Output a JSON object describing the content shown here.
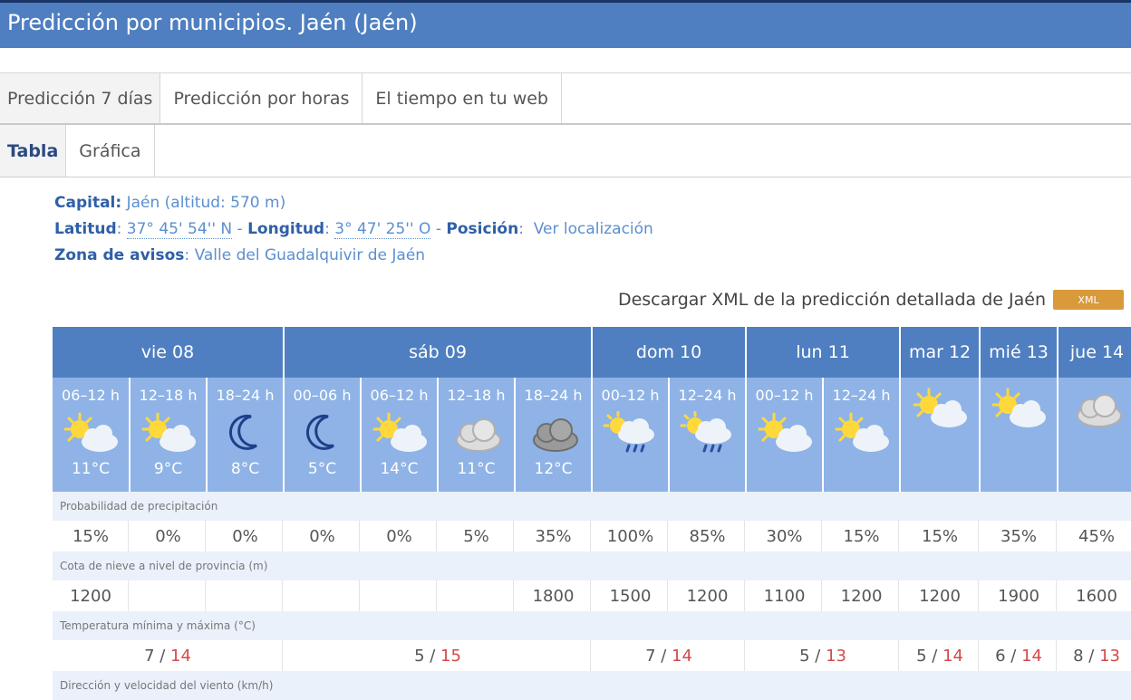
{
  "title": "Predicción por municipios. Jaén (Jaén)",
  "tabs_main": [
    "Predicción 7 días",
    "Predicción por horas",
    "El tiempo en tu web"
  ],
  "tabs_sub": [
    "Tabla",
    "Gráfica"
  ],
  "info": {
    "capital_label": "Capital:",
    "capital_value": "Jaén (altitud: 570 m)",
    "lat_label": "Latitud",
    "lat_value": "37° 45' 54'' N",
    "lon_label": "Longitud",
    "lon_value": "3° 47' 25'' O",
    "pos_label": "Posición",
    "pos_link": "Ver localización",
    "zona_label": "Zona de avisos",
    "zona_value": "Valle del Guadalquivir de Jaén"
  },
  "download": {
    "text": "Descargar XML de la predicción detallada de Jaén",
    "button": "XML"
  },
  "days": [
    {
      "name": "vie 08"
    },
    {
      "name": "sáb 09"
    },
    {
      "name": "dom 10"
    },
    {
      "name": "lun 11"
    },
    {
      "name": "mar 12"
    },
    {
      "name": "mié 13"
    },
    {
      "name": "jue 14"
    }
  ],
  "periods": [
    {
      "label": "06–12 h",
      "icon": "partly-cloudy-sun",
      "temp": "11°C"
    },
    {
      "label": "12–18 h",
      "icon": "partly-cloudy-sun",
      "temp": "9°C"
    },
    {
      "label": "18–24 h",
      "icon": "moon",
      "temp": "8°C"
    },
    {
      "label": "00–06 h",
      "icon": "moon",
      "temp": "5°C"
    },
    {
      "label": "06–12 h",
      "icon": "partly-cloudy-sun",
      "temp": "14°C"
    },
    {
      "label": "12–18 h",
      "icon": "cloudy",
      "temp": "11°C"
    },
    {
      "label": "18–24 h",
      "icon": "dark-cloudy",
      "temp": "12°C"
    },
    {
      "label": "00–12 h",
      "icon": "sun-rain",
      "temp": ""
    },
    {
      "label": "12–24 h",
      "icon": "sun-rain",
      "temp": ""
    },
    {
      "label": "00–12 h",
      "icon": "partly-cloudy-sun",
      "temp": ""
    },
    {
      "label": "12–24 h",
      "icon": "partly-cloudy-sun",
      "temp": ""
    },
    {
      "label": "",
      "icon": "partly-cloudy-sun",
      "temp": ""
    },
    {
      "label": "",
      "icon": "partly-cloudy-sun",
      "temp": ""
    },
    {
      "label": "",
      "icon": "cloudy",
      "temp": ""
    }
  ],
  "rows": {
    "precip_label": "Probabilidad de precipitación",
    "precip": [
      "15%",
      "0%",
      "0%",
      "0%",
      "0%",
      "5%",
      "35%",
      "100%",
      "85%",
      "30%",
      "15%",
      "15%",
      "35%",
      "45%"
    ],
    "snow_label": "Cota de nieve a nivel de provincia (m)",
    "snow": [
      "1200",
      "",
      "",
      "",
      "",
      "",
      "1800",
      "1500",
      "1200",
      "1100",
      "1200",
      "1200",
      "1900",
      "1600"
    ],
    "temp_label": "Temperatura mínima y máxima (°C)",
    "temps": [
      {
        "min": "7",
        "max": "14"
      },
      {
        "min": "5",
        "max": "15"
      },
      {
        "min": "7",
        "max": "14"
      },
      {
        "min": "5",
        "max": "13"
      },
      {
        "min": "5",
        "max": "14"
      },
      {
        "min": "6",
        "max": "14"
      },
      {
        "min": "8",
        "max": "13"
      }
    ],
    "wind_label": "Dirección y velocidad del viento (km/h)"
  },
  "colors": {
    "header_blue": "#4f7fc0",
    "period_blue": "#8fb3e6",
    "max_red": "#d24a4a",
    "xml_orange": "#d89a3a"
  }
}
